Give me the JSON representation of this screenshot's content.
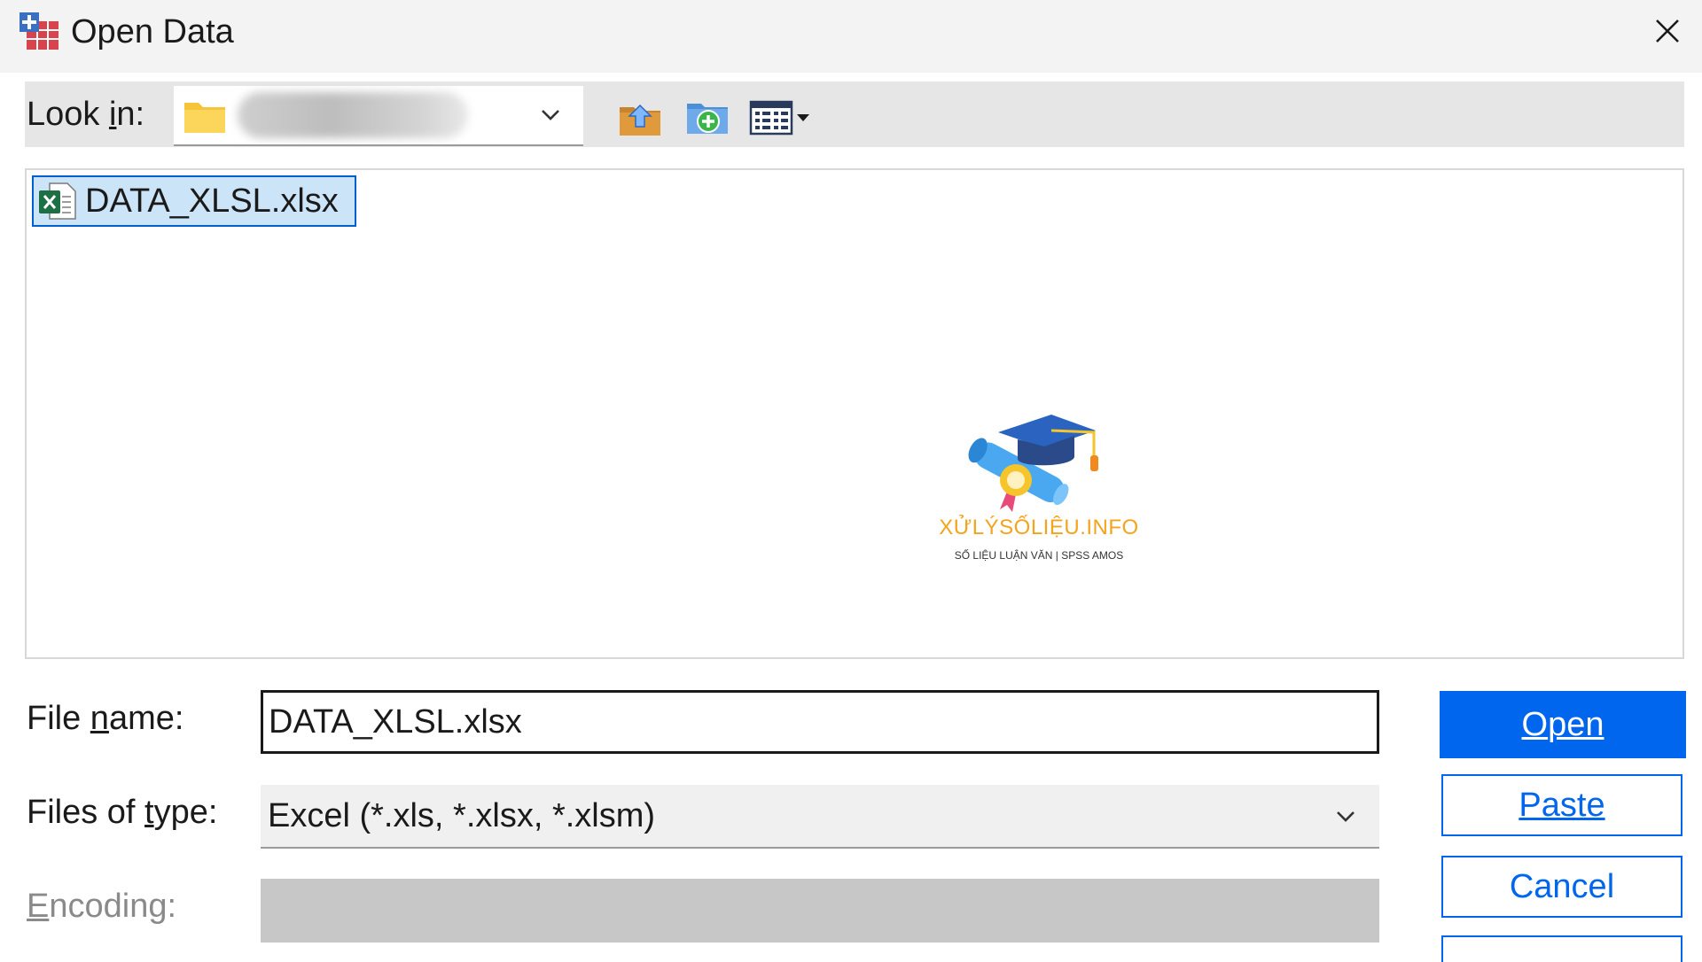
{
  "window": {
    "title": "Open Data",
    "close_icon": "close-icon"
  },
  "toolbar": {
    "look_in_label": "Look in:",
    "current_folder_icon": "folder-icon",
    "buttons": [
      "up-one-level-icon",
      "create-new-folder-icon",
      "view-menu-icon"
    ]
  },
  "file_list": {
    "items": [
      {
        "name": "DATA_XLSL.xlsx",
        "icon": "excel-file-icon",
        "selected": true
      }
    ]
  },
  "watermark": {
    "title": "XỬLÝSỐLIỆU.INFO",
    "subtitle": "SỐ LIỆU LUẬN VĂN | SPSS AMOS"
  },
  "form": {
    "file_name_label": "File name:",
    "file_name_value": "DATA_XLSL.xlsx",
    "file_type_label": "Files of type:",
    "file_type_value": "Excel (*.xls, *.xlsx, *.xlsm)",
    "encoding_label": "Encoding:"
  },
  "buttons": {
    "open": "Open",
    "paste": "Paste",
    "cancel": "Cancel"
  },
  "colors": {
    "accent": "#0066ee",
    "selection": "#cce4f7",
    "watermark": "#f3a41c"
  }
}
